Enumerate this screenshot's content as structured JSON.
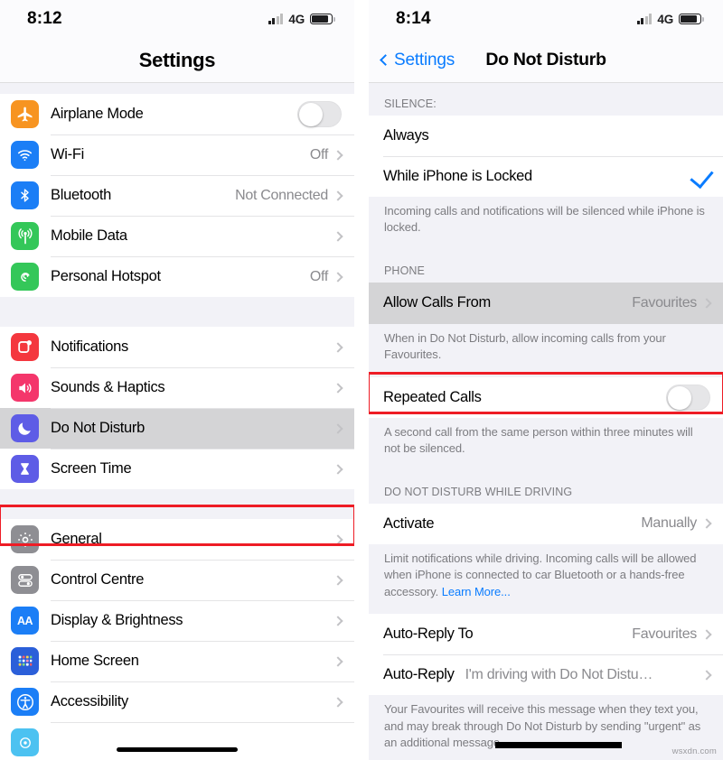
{
  "left_screen": {
    "status_bar": {
      "time": "8:12",
      "network": "4G",
      "signal_icon": "signal-bars-icon",
      "battery_icon": "battery-icon"
    },
    "nav": {
      "title": "Settings"
    },
    "groups": [
      {
        "rows": [
          {
            "icon": "airplane-icon",
            "icon_color": "#f79421",
            "label": "Airplane Mode",
            "control": "toggle",
            "toggle_on": false
          },
          {
            "icon": "wifi-icon",
            "icon_color": "#1b7ef6",
            "label": "Wi-Fi",
            "value": "Off",
            "control": "disclosure"
          },
          {
            "icon": "bluetooth-icon",
            "icon_color": "#1b7ef6",
            "label": "Bluetooth",
            "value": "Not Connected",
            "control": "disclosure"
          },
          {
            "icon": "cellular-icon",
            "icon_color": "#34c759",
            "label": "Mobile Data",
            "value": "",
            "control": "disclosure"
          },
          {
            "icon": "hotspot-icon",
            "icon_color": "#34c759",
            "label": "Personal Hotspot",
            "value": "Off",
            "control": "disclosure"
          }
        ]
      },
      {
        "rows": [
          {
            "icon": "notifications-icon",
            "icon_color": "#f4373e",
            "label": "Notifications",
            "value": "",
            "control": "disclosure"
          },
          {
            "icon": "sounds-icon",
            "icon_color": "#f4366b",
            "label": "Sounds & Haptics",
            "value": "",
            "control": "disclosure"
          },
          {
            "icon": "moon-icon",
            "icon_color": "#5e5ce6",
            "label": "Do Not Disturb",
            "value": "",
            "control": "disclosure",
            "selected": true,
            "highlighted": true
          },
          {
            "icon": "hourglass-icon",
            "icon_color": "#5e5ce6",
            "label": "Screen Time",
            "value": "",
            "control": "disclosure"
          }
        ]
      },
      {
        "rows": [
          {
            "icon": "gear-icon",
            "icon_color": "#8e8e93",
            "label": "General",
            "value": "",
            "control": "disclosure"
          },
          {
            "icon": "control-centre-icon",
            "icon_color": "#8e8e93",
            "label": "Control Centre",
            "value": "",
            "control": "disclosure"
          },
          {
            "icon": "display-brightness-icon",
            "icon_color": "#1b7ef6",
            "label": "Display & Brightness",
            "value": "",
            "control": "disclosure"
          },
          {
            "icon": "home-screen-icon",
            "icon_color": "#2b5fd9",
            "label": "Home Screen",
            "value": "",
            "control": "disclosure"
          },
          {
            "icon": "accessibility-icon",
            "icon_color": "#1b7ef6",
            "label": "Accessibility",
            "value": "",
            "control": "disclosure"
          },
          {
            "icon": "wallpaper-icon",
            "icon_color": "#4cc2f1",
            "label": "",
            "value": "",
            "control": "none",
            "partial": true
          }
        ]
      }
    ]
  },
  "right_screen": {
    "status_bar": {
      "time": "8:14",
      "network": "4G",
      "signal_icon": "signal-bars-icon",
      "battery_icon": "battery-icon"
    },
    "nav": {
      "back_label": "Settings",
      "title": "Do Not Disturb",
      "back_icon": "chevron-left-icon"
    },
    "sections": [
      {
        "header": "SILENCE:",
        "rows": [
          {
            "label": "Always",
            "control": "none"
          },
          {
            "label": "While iPhone is Locked",
            "control": "checkmark",
            "checked": true
          }
        ],
        "footer": "Incoming calls and notifications will be silenced while iPhone is locked."
      },
      {
        "header": "PHONE",
        "rows": [
          {
            "label": "Allow Calls From",
            "value": "Favourites",
            "control": "disclosure",
            "selected": true,
            "highlighted": true
          }
        ],
        "footer": "When in Do Not Disturb, allow incoming calls from your Favourites."
      },
      {
        "header": "",
        "rows": [
          {
            "label": "Repeated Calls",
            "control": "toggle",
            "toggle_on": false
          }
        ],
        "footer": "A second call from the same person within three minutes will not be silenced."
      },
      {
        "header": "DO NOT DISTURB WHILE DRIVING",
        "rows": [
          {
            "label": "Activate",
            "value": "Manually",
            "control": "disclosure"
          }
        ],
        "footer": "Limit notifications while driving. Incoming calls will be allowed when iPhone is connected to car Bluetooth or a hands-free accessory. ",
        "footer_link": "Learn More..."
      },
      {
        "header": "",
        "rows": [
          {
            "label": "Auto-Reply To",
            "value": "Favourites",
            "control": "disclosure"
          },
          {
            "label": "Auto-Reply",
            "value": "I'm driving with Do Not Distu…",
            "control": "disclosure"
          }
        ],
        "footer": "Your Favourites will receive this message when they text you, and may break through Do Not Disturb by sending \"urgent\" as an additional message."
      }
    ]
  },
  "watermark": "wsxdn.com",
  "colors": {
    "accent_blue": "#0a7cff",
    "highlight_red": "#ee1c25",
    "selected_row_gray": "#d4d4d6",
    "group_background": "#f2f2f7"
  }
}
